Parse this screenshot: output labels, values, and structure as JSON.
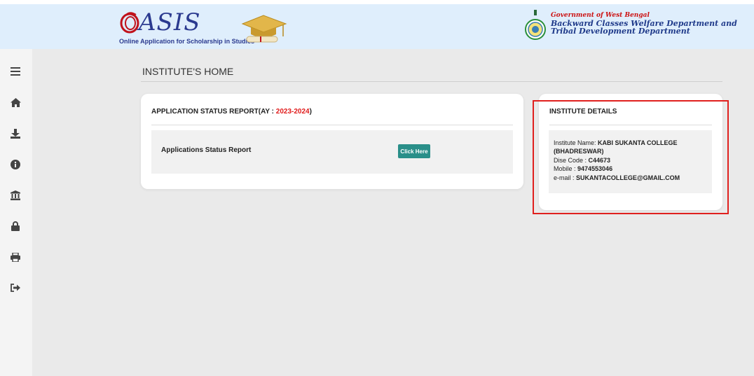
{
  "header": {
    "logo_text": "ASIS",
    "logo_tagline": "Online Application for Scholarship in Studies",
    "gov_line1": "Government of West Bengal",
    "gov_line2": "Backward Classes Welfare Department and",
    "gov_line3": "Tribal Development Department"
  },
  "sidebar": {
    "items": [
      {
        "icon": "menu-icon"
      },
      {
        "icon": "home-icon"
      },
      {
        "icon": "download-icon"
      },
      {
        "icon": "info-icon"
      },
      {
        "icon": "institution-icon"
      },
      {
        "icon": "lock-icon"
      },
      {
        "icon": "print-icon"
      },
      {
        "icon": "logout-icon"
      }
    ]
  },
  "main": {
    "page_title": "INSTITUTE'S HOME",
    "status_card": {
      "title_prefix": "APPLICATION STATUS REPORT(AY : ",
      "year": "2023-2024",
      "title_suffix": ")",
      "row_label": "Applications Status Report",
      "button_label": "Click Here"
    },
    "details_card": {
      "title": "INSTITUTE DETAILS",
      "name_label": "Institute Name: ",
      "name_value_1": "KABI SUKANTA COLLEGE",
      "name_value_2": "(BHADRESWAR)",
      "dise_label": "Dise Code : ",
      "dise_value": "C44673",
      "mobile_label": "Mobile : ",
      "mobile_value": "9474553046",
      "email_label": "e-mail : ",
      "email_value": "SUKANTACOLLEGE@GMAIL.COM"
    }
  },
  "colors": {
    "header_bg": "#dfeefc",
    "accent_red": "#e01b1b",
    "button_teal": "#2a8f89",
    "highlight_border": "#e0201e"
  }
}
